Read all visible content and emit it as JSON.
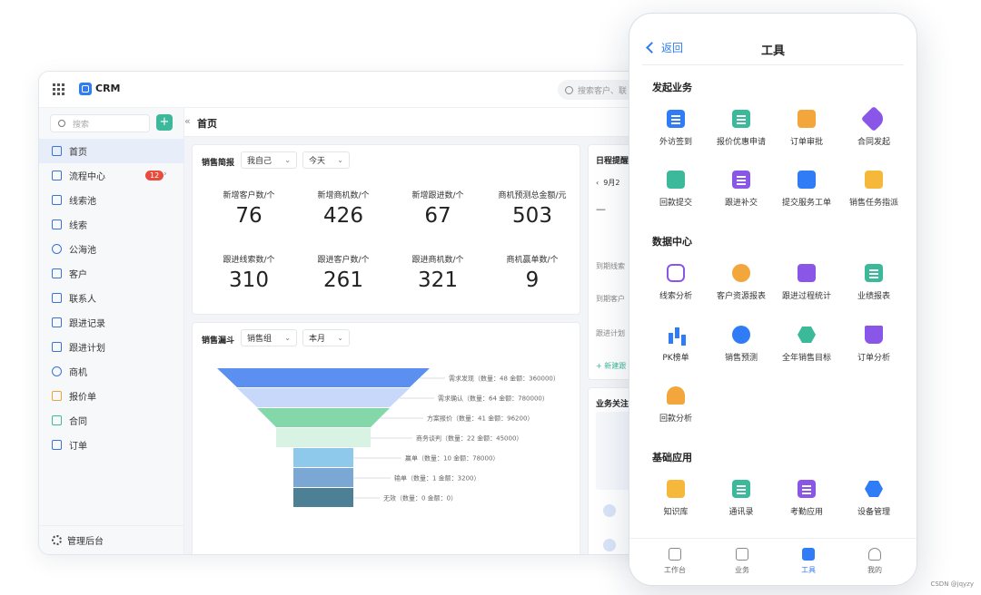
{
  "desktop": {
    "app_name": "CRM",
    "top_search_placeholder": "搜索客户、联",
    "sidebar": {
      "search_placeholder": "搜索",
      "add_label": "+",
      "collapse_label": "«",
      "items": [
        {
          "label": "首页",
          "icon": "home-icon",
          "active": true
        },
        {
          "label": "流程中心",
          "icon": "flow-icon",
          "badge": "12"
        },
        {
          "label": "线索池",
          "icon": "lead-pool-icon"
        },
        {
          "label": "线索",
          "icon": "lead-icon"
        },
        {
          "label": "公海池",
          "icon": "public-pool-icon"
        },
        {
          "label": "客户",
          "icon": "customer-icon"
        },
        {
          "label": "联系人",
          "icon": "contact-icon"
        },
        {
          "label": "跟进记录",
          "icon": "follow-record-icon"
        },
        {
          "label": "跟进计划",
          "icon": "follow-plan-icon"
        },
        {
          "label": "商机",
          "icon": "opportunity-icon"
        },
        {
          "label": "报价单",
          "icon": "quote-icon"
        },
        {
          "label": "合同",
          "icon": "contract-icon"
        },
        {
          "label": "订单",
          "icon": "order-icon"
        }
      ],
      "footer_label": "管理后台"
    },
    "page_title": "首页",
    "sales_brief": {
      "title": "销售简报",
      "filter_owner": "我自己",
      "filter_time": "今天",
      "stats": [
        {
          "label": "新增客户数/个",
          "value": "76"
        },
        {
          "label": "新增商机数/个",
          "value": "426"
        },
        {
          "label": "新增跟进数/个",
          "value": "67"
        },
        {
          "label": "商机预测总金额/元",
          "value": "503"
        },
        {
          "label": "跟进线索数/个",
          "value": "310"
        },
        {
          "label": "跟进客户数/个",
          "value": "261"
        },
        {
          "label": "跟进商机数/个",
          "value": "321"
        },
        {
          "label": "商机赢单数/个",
          "value": "9"
        }
      ]
    },
    "sales_funnel": {
      "title": "销售漏斗",
      "filter_group": "销售组",
      "filter_time": "本月",
      "colors": [
        "#5b8ff0",
        "#c7d8fa",
        "#84d7a8",
        "#d8f2e3",
        "#8ec8ea",
        "#7ba7d4",
        "#4d7f95"
      ]
    },
    "schedule": {
      "title": "日程提醒",
      "date": "9月2",
      "dash": "—",
      "rows": [
        "到期线索",
        "到期客户",
        "跟进计划"
      ],
      "new_label": "+ 新建跟"
    },
    "focus": {
      "title": "业务关注"
    }
  },
  "chart_data": {
    "type": "funnel",
    "categories": [
      "需求发现",
      "需求确认",
      "方案报价",
      "商务谈判",
      "赢单",
      "输单",
      "无效"
    ],
    "series": [
      {
        "name": "数量",
        "values": [
          48,
          64,
          41,
          22,
          10,
          1,
          0
        ]
      },
      {
        "name": "金额",
        "values": [
          360000,
          780000,
          96200,
          45000,
          78000,
          3200,
          0
        ]
      }
    ],
    "labels": [
      "需求发现（数量：48  金额：360000）",
      "需求确认（数量：64  金额：780000）",
      "方案报价（数量：41  金额：96200）",
      "商务谈判（数量：22  金额：45000）",
      "赢单（数量：10  金额：78000）",
      "输单（数量：1  金额：3200）",
      "无效（数量：0  金额：0）"
    ]
  },
  "mobile": {
    "back_label": "返回",
    "title": "工具",
    "sections": [
      {
        "title": "发起业务",
        "tools": [
          {
            "label": "外访签到",
            "icon": "checkin-icon",
            "color": "blue"
          },
          {
            "label": "报价优惠申请",
            "icon": "discount-icon",
            "color": "green"
          },
          {
            "label": "订单审批",
            "icon": "stamp-icon",
            "color": "orange"
          },
          {
            "label": "合同发起",
            "icon": "tag-icon",
            "color": "purple"
          },
          {
            "label": "回款提交",
            "icon": "wallet-icon",
            "color": "green"
          },
          {
            "label": "跟进补交",
            "icon": "doc-edit-icon",
            "color": "purple"
          },
          {
            "label": "提交服务工单",
            "icon": "mail-icon",
            "color": "blue"
          },
          {
            "label": "销售任务指派",
            "icon": "card-icon",
            "color": "yellow"
          }
        ]
      },
      {
        "title": "数据中心",
        "tools": [
          {
            "label": "线索分析",
            "icon": "route-icon",
            "color": "purple"
          },
          {
            "label": "客户资源报表",
            "icon": "user-icon",
            "color": "orange"
          },
          {
            "label": "跟进过程统计",
            "icon": "monitor-icon",
            "color": "purple"
          },
          {
            "label": "业绩报表",
            "icon": "report-icon",
            "color": "green"
          },
          {
            "label": "PK榜单",
            "icon": "bars-icon",
            "color": "blue"
          },
          {
            "label": "销售预测",
            "icon": "pie-icon",
            "color": "blue"
          },
          {
            "label": "全年销售目标",
            "icon": "target-icon",
            "color": "green"
          },
          {
            "label": "订单分析",
            "icon": "cart-icon",
            "color": "purple"
          },
          {
            "label": "回款分析",
            "icon": "alarm-icon",
            "color": "orange"
          }
        ]
      },
      {
        "title": "基础应用",
        "tools": [
          {
            "label": "知识库",
            "icon": "book-icon",
            "color": "yellow"
          },
          {
            "label": "通讯录",
            "icon": "addressbook-icon",
            "color": "green"
          },
          {
            "label": "考勤应用",
            "icon": "attendance-icon",
            "color": "purple"
          },
          {
            "label": "设备管理",
            "icon": "device-icon",
            "color": "blue"
          }
        ]
      }
    ],
    "tabbar": [
      {
        "label": "工作台",
        "icon": "grid-icon"
      },
      {
        "label": "业务",
        "icon": "doc-icon"
      },
      {
        "label": "工具",
        "icon": "cube-icon",
        "active": true
      },
      {
        "label": "我的",
        "icon": "profile-icon"
      }
    ]
  },
  "watermark": "CSDN @jqyzy"
}
